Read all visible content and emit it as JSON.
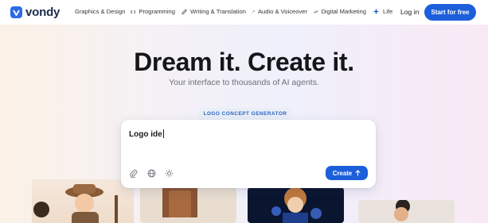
{
  "brand": {
    "name": "vondy",
    "accent": "#1d5fdb"
  },
  "nav": {
    "items": [
      {
        "label": "Graphics & Design",
        "icon": "palette-icon"
      },
      {
        "label": "Programming",
        "icon": "code-icon"
      },
      {
        "label": "Writing & Translation",
        "icon": "pen-icon"
      },
      {
        "label": "Audio & Voiceover",
        "icon": "microphone-icon"
      },
      {
        "label": "Digital Marketing",
        "icon": "trend-icon"
      },
      {
        "label": "Life",
        "icon": "sparkle-icon"
      }
    ],
    "login_label": "Log in",
    "cta_label": "Start for free"
  },
  "hero": {
    "title": "Dream it. Create it.",
    "subtitle": "Your interface to thousands of AI agents."
  },
  "generator": {
    "mode_label": "LOGO CONCEPT GENERATOR",
    "prompt_value": "Logo ide",
    "tools": [
      "paperclip-icon",
      "globe-icon",
      "sun-icon"
    ],
    "create_label": "Create"
  }
}
